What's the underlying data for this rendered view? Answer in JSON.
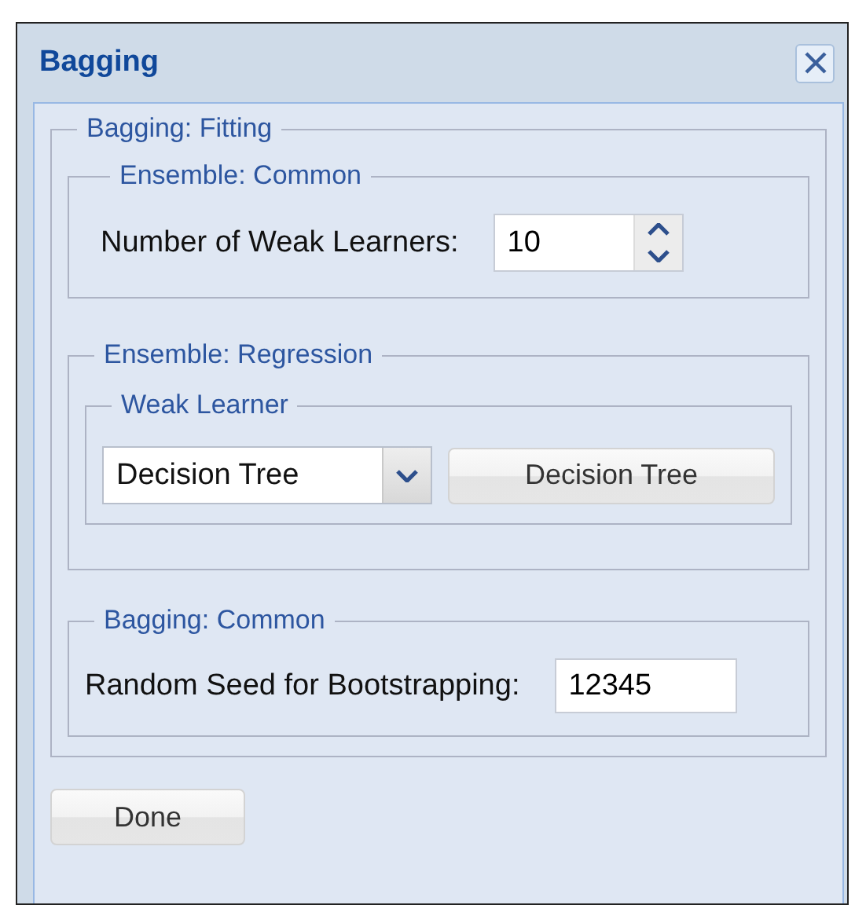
{
  "window": {
    "title": "Bagging"
  },
  "fitting": {
    "legend": "Bagging: Fitting",
    "common": {
      "legend": "Ensemble: Common",
      "label": "Number of Weak Learners:",
      "value": "10"
    },
    "regression": {
      "legend": "Ensemble: Regression",
      "weak_learner": {
        "legend": "Weak Learner",
        "select_value": "Decision Tree",
        "button": "Decision Tree"
      }
    },
    "bagging_common": {
      "legend": "Bagging: Common",
      "label": "Random Seed for Bootstrapping:",
      "value": "12345"
    }
  },
  "buttons": [
    "Done"
  ]
}
